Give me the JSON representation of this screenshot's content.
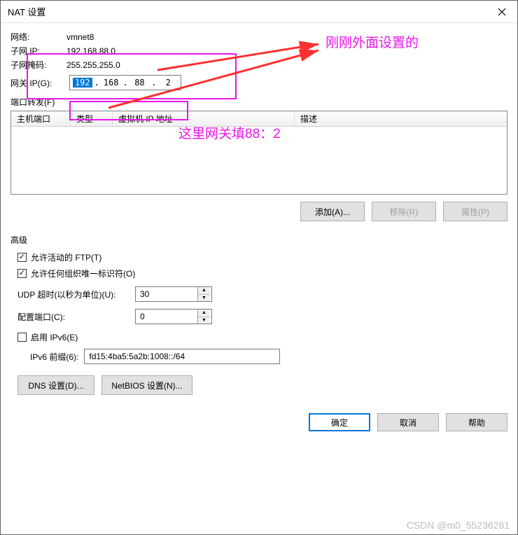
{
  "title": "NAT 设置",
  "network": {
    "label": "网络:",
    "value": "vmnet8"
  },
  "subnet_ip": {
    "label": "子网 IP:",
    "value": "192.168.88.0"
  },
  "subnet_mask": {
    "label": "子网掩码:",
    "value": "255.255.255.0"
  },
  "gateway": {
    "label": "网关 IP(G):",
    "oct1": "192",
    "oct2": "168",
    "oct3": "88",
    "oct4": "2"
  },
  "port_forwarding": {
    "label": "端口转发(F)",
    "headers": {
      "host_port": "主机端口",
      "type": "类型",
      "vm_ip": "虚拟机 IP 地址",
      "desc": "描述"
    },
    "add": "添加(A)...",
    "remove": "移除(R)",
    "properties": "属性(P)"
  },
  "advanced": {
    "label": "高级",
    "ftp": "允许活动的 FTP(T)",
    "oui": "允许任何组织唯一标识符(O)",
    "udp_label": "UDP 超时(以秒为单位)(U):",
    "udp_value": "30",
    "config_port_label": "配置端口(C):",
    "config_port_value": "0",
    "enable_ipv6": "启用 IPv6(E)",
    "ipv6_prefix_label": "IPv6 前缀(6):",
    "ipv6_prefix_value": "fd15:4ba5:5a2b:1008::/64",
    "dns_btn": "DNS 设置(D)...",
    "netbios_btn": "NetBIOS 设置(N)..."
  },
  "dialog": {
    "ok": "确定",
    "cancel": "取消",
    "help": "帮助"
  },
  "annotations": {
    "top": "刚刚外面设置的",
    "bottom": "这里网关填88：2"
  },
  "watermark": "CSDN @m0_55236281"
}
